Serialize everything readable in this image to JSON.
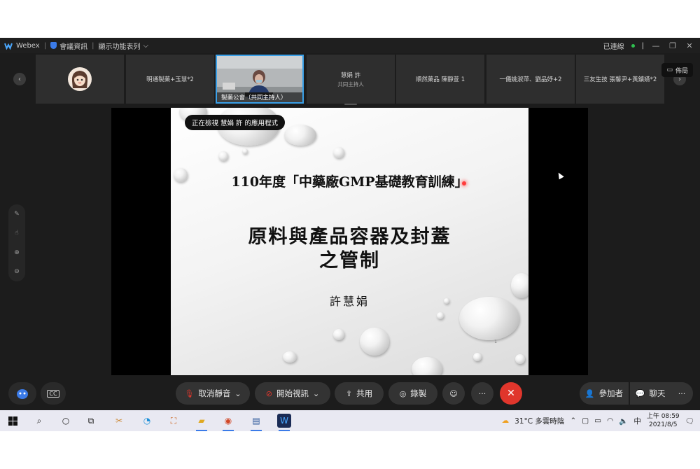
{
  "titlebar": {
    "app_name": "Webex",
    "meeting_info": "會議資訊",
    "show_menu": "顯示功能表列",
    "status": "已連線"
  },
  "participants": [
    {
      "name": "",
      "sub": ""
    },
    {
      "name": "明通製藥+玉慧*2",
      "sub": ""
    },
    {
      "name": "製藥公會（共同主持人）",
      "sub": ""
    },
    {
      "name": "慧娟 許",
      "sub": "共同主持人"
    },
    {
      "name": "順然藥品 陳靜萱 1",
      "sub": ""
    },
    {
      "name": "一儀姚淑萍、劉品妤+2",
      "sub": ""
    },
    {
      "name": "三友生技 張馨尹+黃鑛嬿*2",
      "sub": ""
    }
  ],
  "layout_label": "佈局",
  "share": {
    "viewing_badge": "正在檢視 慧娟 許 的應用程式",
    "slide_line1": "110年度「中藥廠GMP基礎教育訓練」",
    "slide_line2a": "原料與產品容器及封蓋",
    "slide_line2b": "之管制",
    "slide_author": "許慧娟",
    "slide_page": "1"
  },
  "controls": {
    "unmute": "取消靜音",
    "start_video": "開始視訊",
    "share": "共用",
    "record": "錄製",
    "participants": "參加者",
    "chat": "聊天",
    "cc": "CC",
    "more": "···",
    "end": "✕"
  },
  "taskbar": {
    "weather": "31°C  多雲時陰",
    "ime": "中",
    "time": "上午 08:59",
    "date": "2021/8/5"
  },
  "colors": {
    "accent_blue": "#3aa0e8",
    "end_red": "#e0362c",
    "connected_green": "#2fbf4f"
  }
}
